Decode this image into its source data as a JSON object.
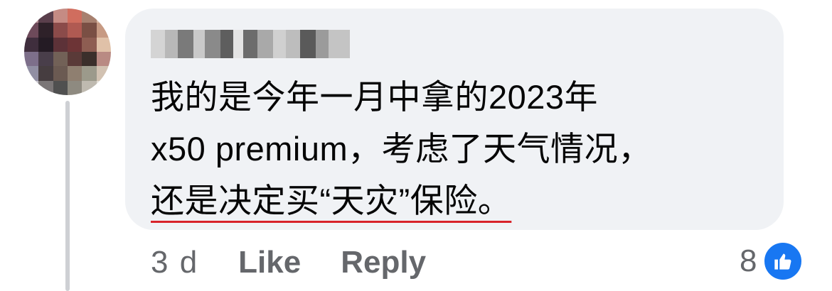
{
  "comment": {
    "author_name": "",
    "lines": [
      "我的是今年一月中拿的2023年",
      "x50 premium，考虑了天气情况，",
      "还是决定买“天灾”保险。"
    ]
  },
  "actions": {
    "timestamp": "3 d",
    "like_label": "Like",
    "reply_label": "Reply"
  },
  "reactions": {
    "count": "8",
    "icon": "thumbs-up-icon"
  },
  "colors": {
    "bubble": "#f0f2f5",
    "secondary_text": "#65676b",
    "like_blue": "#1877f2",
    "underline_red": "#d8232a"
  }
}
